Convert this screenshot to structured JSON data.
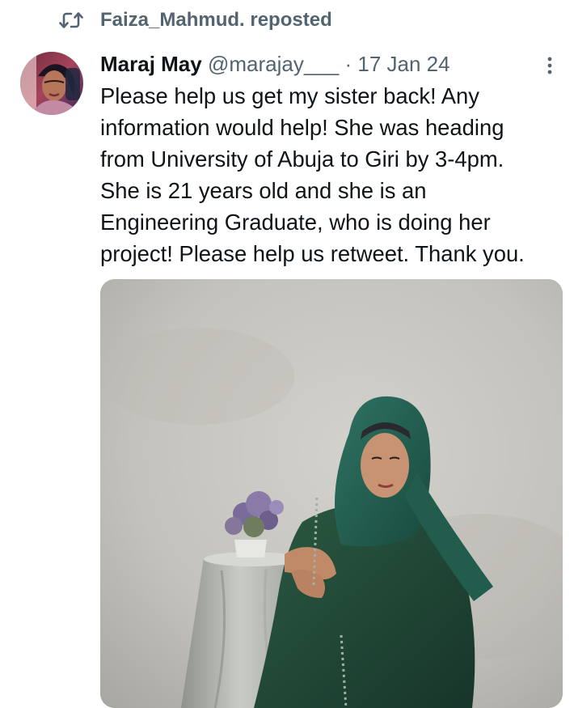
{
  "repost": {
    "icon": "repost-icon",
    "text": "Faiza_Mahmud. reposted"
  },
  "tweet": {
    "author_name": "Maraj May",
    "author_handle": "@marajay___",
    "separator": "·",
    "timestamp": "17 Jan 24",
    "more_icon": "more-vertical-icon",
    "text_lines": [
      "Please help us get my sister back! Any",
      "information would help! She was heading",
      "from University of Abuja to Giri by 3-4pm.",
      "She is 21 years old and she is an",
      "Engineering Graduate, who is doing her",
      "project! Please help us retweet. Thank you."
    ],
    "media": {
      "description_icon": "photo-woman-green-hijab"
    }
  },
  "colors": {
    "secondary_text": "#536471",
    "primary_text": "#0f1419",
    "hijab_green": "#1f5a4a",
    "dress_green": "#234a36",
    "backdrop": "#c9c7c1"
  }
}
